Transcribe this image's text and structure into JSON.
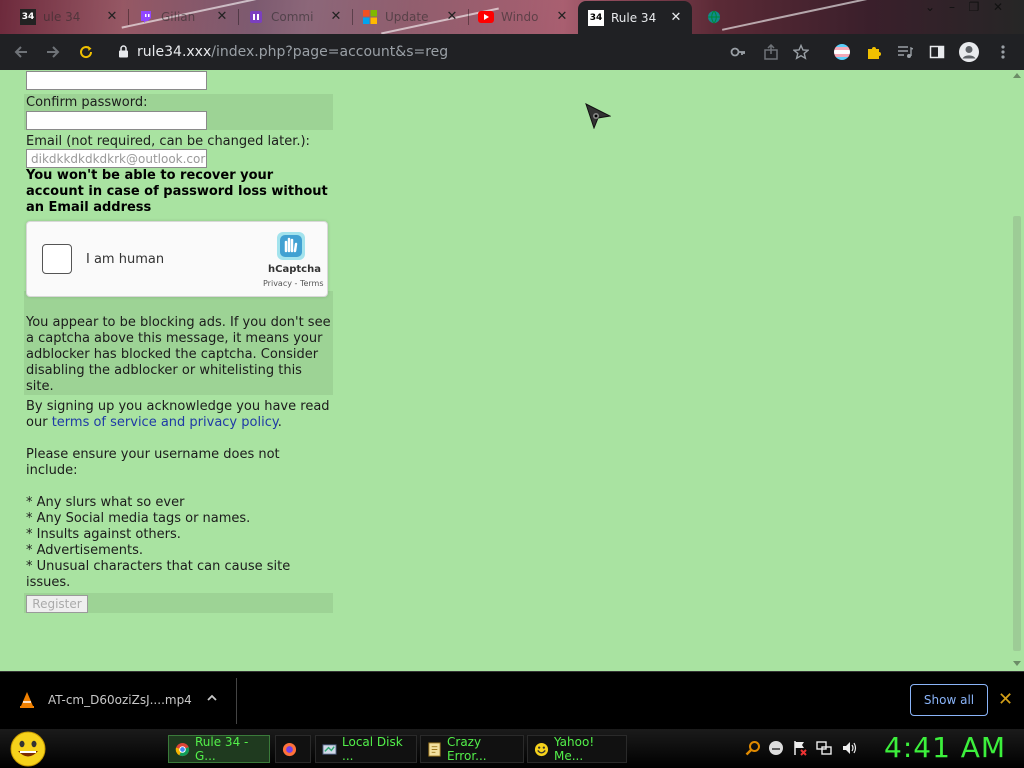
{
  "tabs": [
    {
      "label": "ule 34",
      "favicon": "34"
    },
    {
      "label": "Gilian",
      "favicon": "twitch"
    },
    {
      "label": "Commi",
      "favicon": "purple"
    },
    {
      "label": "Update",
      "favicon": "microsoft"
    },
    {
      "label": "Windo",
      "favicon": "youtube"
    },
    {
      "label": "Rule 34",
      "favicon": "34",
      "active": true
    },
    {
      "label": "",
      "favicon": "globe"
    }
  ],
  "address_bar": {
    "domain": "rule34.xxx",
    "path": "/index.php?page=account&s=reg"
  },
  "form": {
    "confirm_password_label": "Confirm password:",
    "email_label": "Email (not required, can be changed later.):",
    "email_value": "dikdkkdkdkdkrk@outlook.cor",
    "warning": "You won't be able to recover your account in case of password loss without an Email address",
    "captcha": {
      "checkbox_label": "I am human",
      "brand": "hCaptcha",
      "links": "Privacy - Terms"
    },
    "adblock_notice": "You appear to be blocking ads. If you don't see a captcha above this message, it means your adblocker has blocked the captcha. Consider disabling the adblocker or whitelisting this site.",
    "tos_prefix": "By signing up you acknowledge you have read our",
    "tos_link": "terms of service and privacy policy",
    "tos_suffix": ".",
    "username_rules_intro": "Please ensure your username does not include:",
    "username_rules": [
      "* Any slurs what so ever",
      "* Any Social media tags or names.",
      "* Insults against others.",
      "* Advertisements.",
      "* Unusual characters that can cause site issues."
    ],
    "register_button": "Register"
  },
  "download_bar": {
    "filename": "AT-cm_D60oziZsJ....mp4",
    "show_all": "Show all"
  },
  "taskbar": {
    "tasks": [
      {
        "label": "Rule 34 - G...",
        "icon": "chrome-icon",
        "active": true
      },
      {
        "label": "",
        "icon": "firefox-icon"
      },
      {
        "label": "Local Disk ...",
        "icon": "drive-icon"
      },
      {
        "label": "Crazy Error...",
        "icon": "error-icon"
      },
      {
        "label": "Yahoo! Me...",
        "icon": "yahoo-icon"
      }
    ],
    "clock": "4:41 AM"
  },
  "colors": {
    "page_bg": "#a9e3a1",
    "row_shade": "#9dd395",
    "link": "#1f3aa6",
    "clock": "#3cf03c",
    "taskbar_text": "#53f04a",
    "show_all": "#8ab4f8"
  }
}
